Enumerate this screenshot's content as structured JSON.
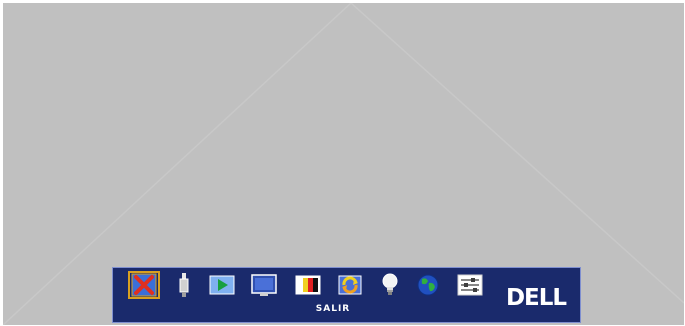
{
  "osd": {
    "menu_items": [
      {
        "icon": "exit-icon"
      },
      {
        "icon": "input-source-icon"
      },
      {
        "icon": "play-icon"
      },
      {
        "icon": "display-screen-icon"
      },
      {
        "icon": "color-bars-icon"
      },
      {
        "icon": "auto-adjust-icon"
      },
      {
        "icon": "lamp-icon"
      },
      {
        "icon": "language-globe-icon"
      },
      {
        "icon": "settings-sliders-icon"
      }
    ],
    "selected_index": 0,
    "selected_label": "SALIR",
    "brand": "DELL"
  },
  "colors": {
    "background": "#c0c0c0",
    "osd_bar": "#1a2a6c",
    "selection": "#d9a020"
  }
}
